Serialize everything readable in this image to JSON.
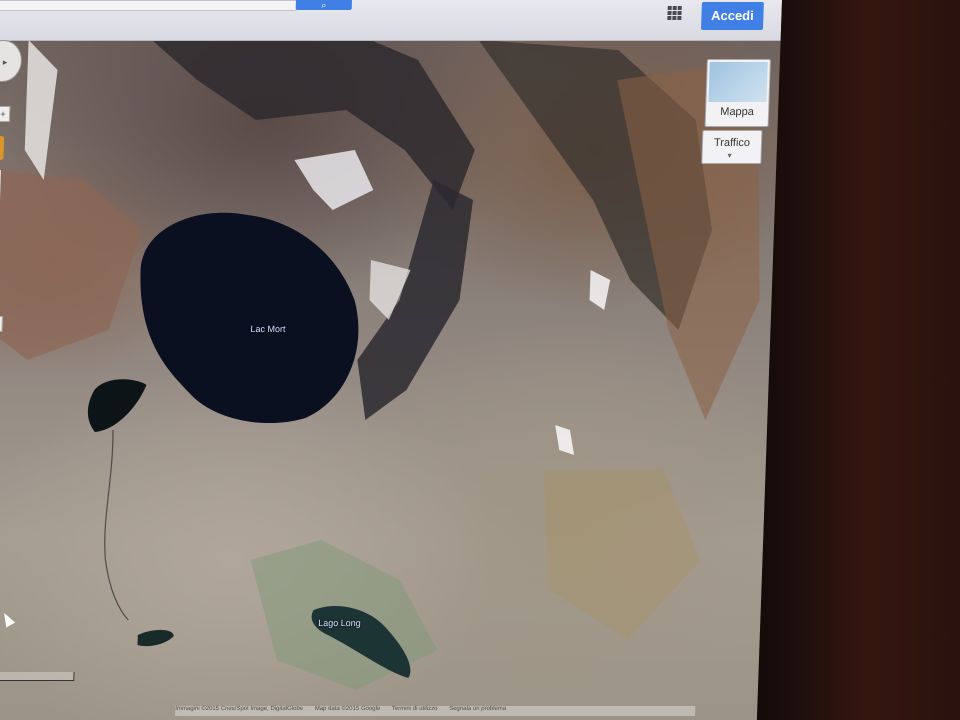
{
  "header": {
    "search_button_icon": "search-icon",
    "apps_icon": "apps-grid-icon",
    "signin_label": "Accedi"
  },
  "controls": {
    "zoom_in_label": "+",
    "zoom_out_label": "–",
    "map_type_label": "Mappa",
    "traffic_label": "Traffico",
    "traffic_caret": "▾"
  },
  "map": {
    "labels": {
      "lake_main": "Lac Mort",
      "lake_small": "Lago Long"
    }
  },
  "footer": {
    "imagery": "Immagini ©2015 Cnes/Spot Image, DigitalGlobe",
    "map_data": "Map data ©2015 Google",
    "terms": "Termini di utilizzo",
    "report": "Segnala un problema"
  },
  "colors": {
    "accent": "#3f7fe6",
    "lake": "#0b1020"
  }
}
